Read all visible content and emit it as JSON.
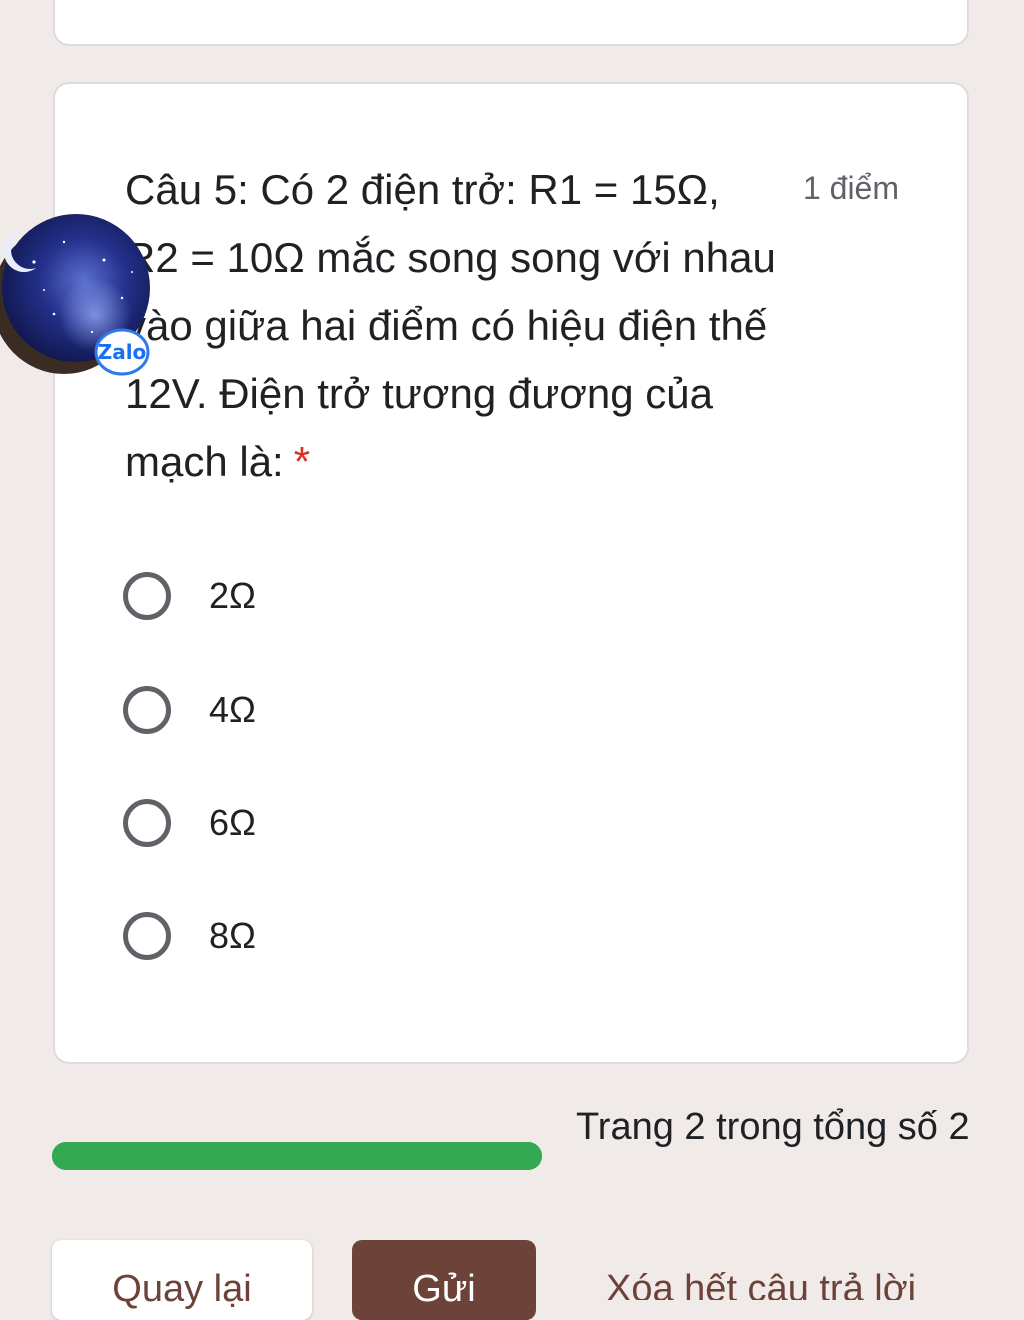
{
  "question": {
    "text": "Câu 5: Có 2 điện trở: R1 = 15Ω, R2 = 10Ω mắc song song với nhau vào giữa hai điểm có hiệu điện thế 12V. Điện trở tương đương của mạch là:",
    "required_mark": "*",
    "points": "1 điểm",
    "options": [
      {
        "label": "2Ω",
        "selected": false
      },
      {
        "label": "4Ω",
        "selected": false
      },
      {
        "label": "6Ω",
        "selected": false
      },
      {
        "label": "8Ω",
        "selected": false
      }
    ]
  },
  "progress": {
    "page_text": "Trang 2 trong tổng số 2",
    "fraction": 1.0,
    "color": "#34a853"
  },
  "footer": {
    "back_label": "Quay lại",
    "submit_label": "Gửi",
    "clear_label": "Xóa hết câu trả lời"
  },
  "floating": {
    "badge_label": "Zalo",
    "icon": "zalo-chat-head"
  },
  "colors": {
    "background": "#f0ebe9",
    "accent": "#6d4239",
    "required": "#d93025"
  }
}
